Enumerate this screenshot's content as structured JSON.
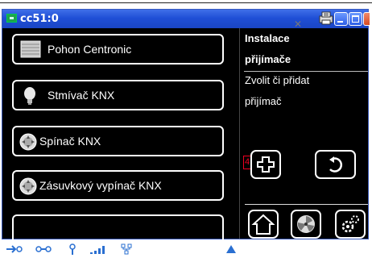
{
  "window": {
    "title": "cc51:0"
  },
  "list": {
    "items": [
      {
        "label": "Pohon Centronic",
        "icon": "shutter-icon"
      },
      {
        "label": "Stmívač KNX",
        "icon": "bulb-icon"
      },
      {
        "label": "Spínač KNX",
        "icon": "switch-icon"
      },
      {
        "label": "Zásuvkový vypínač KNX",
        "icon": "socket-switch-icon"
      }
    ]
  },
  "panel": {
    "heading_line1": "Instalace",
    "heading_line2": "přijímače",
    "subtitle_line1": "Zvolit či přidat",
    "subtitle_line2": "přijímač",
    "badge": "4"
  },
  "buttons": {
    "add": "add-icon",
    "back": "back-icon",
    "home": "home-icon",
    "fan": "fan-icon",
    "settings": "settings-icon"
  },
  "colors": {
    "accent": "#2a6fd1",
    "titlebar": "#1f4fd6",
    "background": "#000000",
    "badge": "#e02020"
  }
}
